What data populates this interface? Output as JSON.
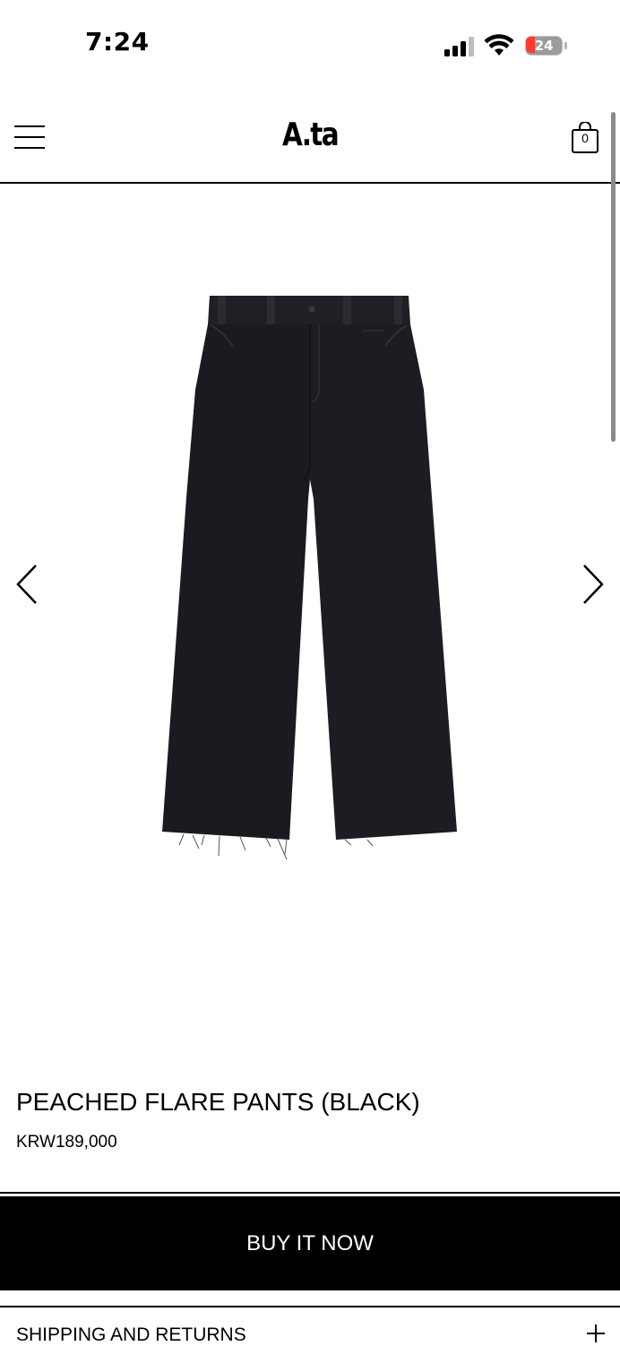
{
  "status_bar": {
    "time": "7:24",
    "battery": "24",
    "icons": [
      "cellular-signal-icon",
      "wifi-icon",
      "battery-icon"
    ]
  },
  "header": {
    "logo": "A.ta",
    "cart_count": "0",
    "icons": [
      "hamburger-menu-icon",
      "shopping-bag-icon"
    ]
  },
  "gallery": {
    "icons": [
      "chevron-left-icon",
      "chevron-right-icon"
    ],
    "image": "black-pants-photo"
  },
  "product": {
    "title": "PEACHED FLARE PANTS (BLACK)",
    "price": "KRW189,000"
  },
  "actions": {
    "buy_label": "BUY IT NOW"
  },
  "accordion": {
    "shipping_label": "SHIPPING AND RETURNS",
    "icon": "plus-icon"
  },
  "colors": {
    "text": "#000000",
    "background": "#ffffff",
    "button_bg": "#000000",
    "button_text": "#ffffff",
    "battery_low": "#ff3b30"
  }
}
